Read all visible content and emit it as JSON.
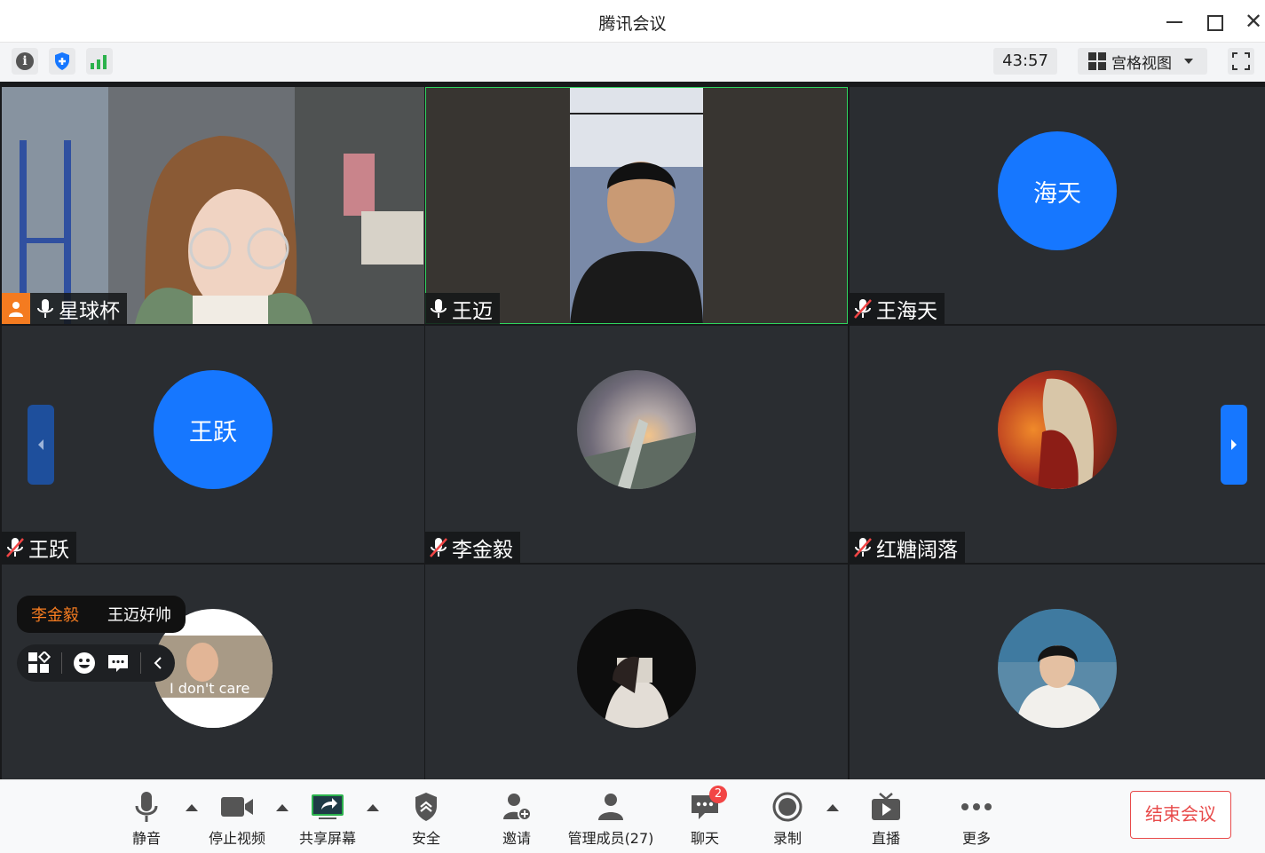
{
  "window": {
    "title": "腾讯会议"
  },
  "toolbar": {
    "timer": "43:57",
    "view_mode": "宫格视图"
  },
  "participants": [
    {
      "name": "星球杯",
      "mic": "on",
      "host": true,
      "type": "video"
    },
    {
      "name": "王迈",
      "mic": "on",
      "host": false,
      "type": "video",
      "active_speaker": true
    },
    {
      "name": "王海天",
      "mic": "muted",
      "type": "avatar_text",
      "avatar_text": "海天"
    },
    {
      "name": "王跃",
      "mic": "muted",
      "type": "avatar_text",
      "avatar_text": "王跃"
    },
    {
      "name": "李金毅",
      "mic": "muted",
      "type": "avatar_image"
    },
    {
      "name": "红糖阔落",
      "mic": "muted",
      "type": "avatar_image"
    },
    {
      "name": "",
      "type": "avatar_image",
      "avatar_caption": "I don't care"
    },
    {
      "name": "",
      "type": "avatar_image"
    },
    {
      "name": "",
      "type": "avatar_image"
    }
  ],
  "chat_popup": {
    "sender": "李金毅",
    "message": "王迈好帅"
  },
  "bottombar": {
    "mute": "静音",
    "stop_video": "停止视频",
    "share_screen": "共享屏幕",
    "security": "安全",
    "invite": "邀请",
    "manage_members": "管理成员(27)",
    "chat": "聊天",
    "chat_badge": "2",
    "record": "录制",
    "live": "直播",
    "more": "更多",
    "end_meeting": "结束会议"
  },
  "colors": {
    "accent": "#1677ff",
    "host_badge": "#f47b20",
    "end_button": "#e84b4b",
    "active_border": "#2fd35e"
  }
}
